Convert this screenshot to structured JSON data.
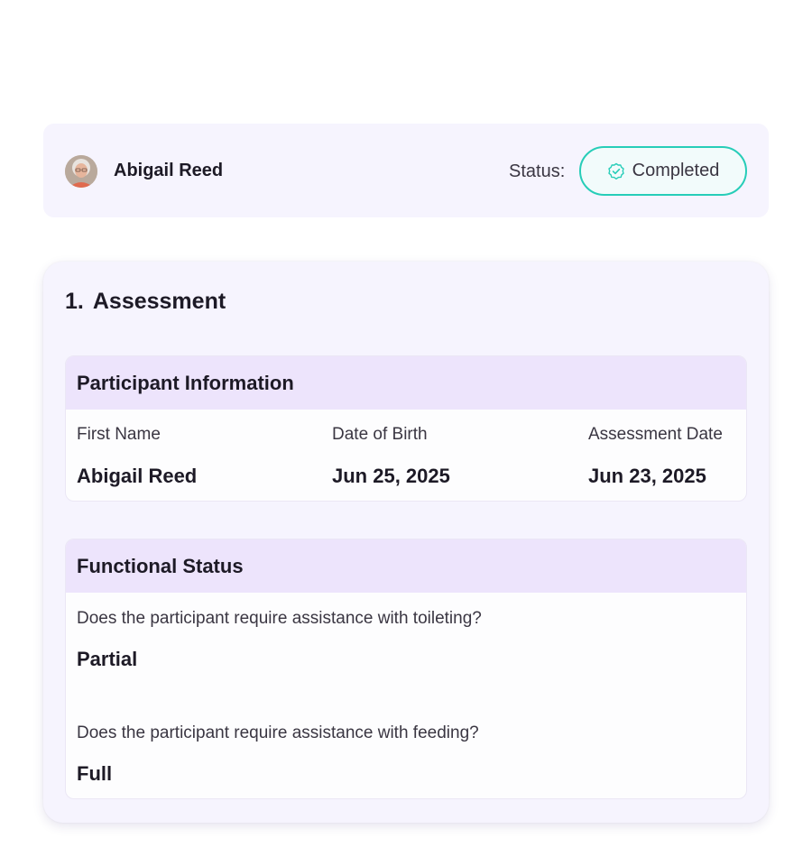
{
  "header": {
    "participant_name": "Abigail Reed",
    "status_label": "Status:",
    "status_value": "Completed",
    "status_color": "#27cdb8"
  },
  "assessment": {
    "number": "1.",
    "title": "Assessment",
    "participant_info": {
      "title": "Participant Information",
      "fields": [
        {
          "label": "First Name",
          "value": "Abigail Reed"
        },
        {
          "label": "Date of Birth",
          "value": "Jun 25, 2025"
        },
        {
          "label": "Assessment Date",
          "value": "Jun 23, 2025"
        }
      ]
    },
    "functional_status": {
      "title": "Functional Status",
      "questions": [
        {
          "question": "Does the participant require assistance with toileting?",
          "answer": "Partial"
        },
        {
          "question": "Does the participant require assistance with feeding?",
          "answer": "Full"
        }
      ]
    }
  },
  "icons": {
    "avatar": "avatar",
    "status": "check-circle-icon"
  }
}
